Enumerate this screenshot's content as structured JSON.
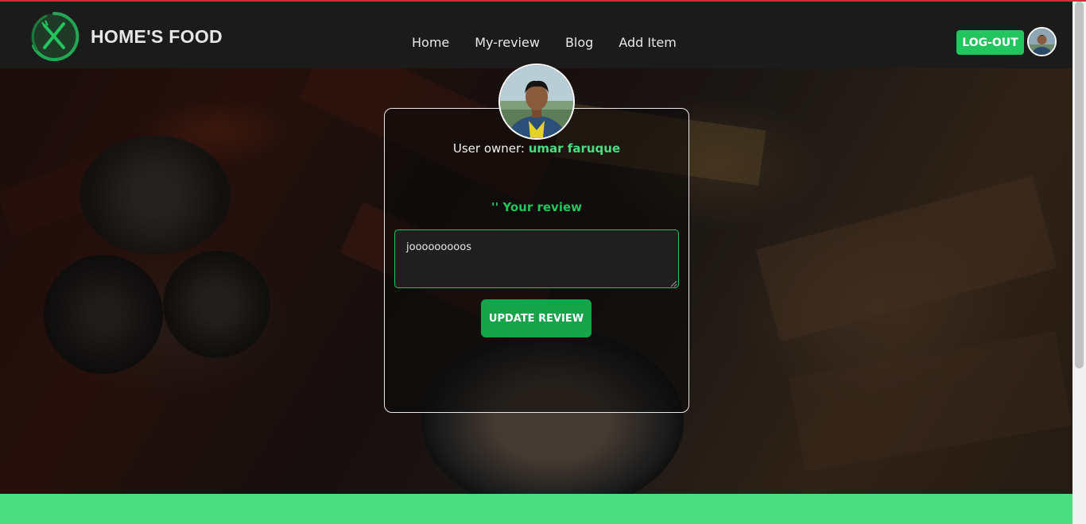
{
  "brand": {
    "title": "HOME'S FOOD",
    "logo_icon": "fork-knife-icon",
    "accent": "#22c55e"
  },
  "nav": {
    "items": [
      {
        "label": "Home"
      },
      {
        "label": "My-review"
      },
      {
        "label": "Blog"
      },
      {
        "label": "Add Item"
      }
    ],
    "logout_label": "LOG-OUT"
  },
  "card": {
    "owner_prefix": "User owner:",
    "owner_name": "umar faruque",
    "review_heading": "'' Your review",
    "review_value": "jooooooooos",
    "update_label": "UPDATE REVIEW"
  },
  "colors": {
    "green": "#22c55e",
    "green_light": "#4ade80",
    "footer": "#4ade80",
    "navbar": "#1b1b1b"
  }
}
